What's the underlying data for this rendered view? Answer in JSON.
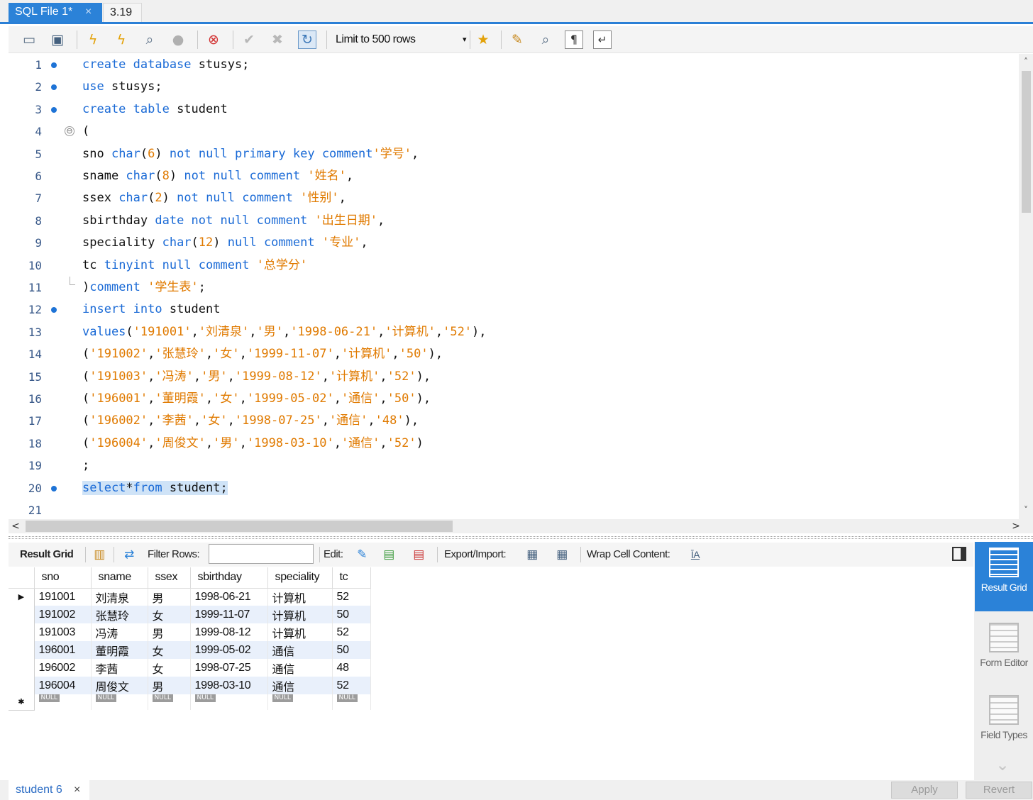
{
  "tabs": [
    {
      "label": "SQL File 1*",
      "close": "×"
    },
    {
      "label": "3.19"
    }
  ],
  "toolbar": {
    "limit_label": "Limit to 500 rows",
    "dropdown_arrow": "▾",
    "icons": [
      "open-folder-icon",
      "save-icon",
      "execute-icon",
      "execute-current-icon",
      "explain-icon",
      "stop-icon",
      "toggle-error-stop-icon",
      "commit-icon",
      "rollback-icon",
      "autocommit-icon",
      "add-snippet-icon",
      "beautify-icon",
      "find-icon",
      "invisible-chars-icon",
      "wrap-icon"
    ]
  },
  "editor": {
    "lines": [
      {
        "n": "1",
        "dot": true,
        "tokens": [
          [
            "k",
            "create database"
          ],
          [
            "t",
            " stusys;"
          ]
        ]
      },
      {
        "n": "2",
        "dot": true,
        "tokens": [
          [
            "k",
            "use"
          ],
          [
            "t",
            " stusys;"
          ]
        ]
      },
      {
        "n": "3",
        "dot": true,
        "tokens": [
          [
            "k",
            "create table"
          ],
          [
            "t",
            " student"
          ]
        ]
      },
      {
        "n": "4",
        "fold": "⊖",
        "tokens": [
          [
            "t",
            "("
          ]
        ]
      },
      {
        "n": "5",
        "tokens": [
          [
            "t",
            "sno "
          ],
          [
            "k",
            "char"
          ],
          [
            "t",
            "("
          ],
          [
            "s",
            "6"
          ],
          [
            "t",
            ") "
          ],
          [
            "k",
            "not null primary key comment"
          ],
          [
            "s",
            "'学号'"
          ],
          [
            "t",
            ","
          ]
        ]
      },
      {
        "n": "6",
        "tokens": [
          [
            "t",
            "sname "
          ],
          [
            "k",
            "char"
          ],
          [
            "t",
            "("
          ],
          [
            "s",
            "8"
          ],
          [
            "t",
            ") "
          ],
          [
            "k",
            "not null comment"
          ],
          [
            "t",
            " "
          ],
          [
            "s",
            "'姓名'"
          ],
          [
            "t",
            ","
          ]
        ]
      },
      {
        "n": "7",
        "tokens": [
          [
            "t",
            "ssex "
          ],
          [
            "k",
            "char"
          ],
          [
            "t",
            "("
          ],
          [
            "s",
            "2"
          ],
          [
            "t",
            ") "
          ],
          [
            "k",
            "not null comment"
          ],
          [
            "t",
            " "
          ],
          [
            "s",
            "'性别'"
          ],
          [
            "t",
            ","
          ]
        ]
      },
      {
        "n": "8",
        "tokens": [
          [
            "t",
            "sbirthday "
          ],
          [
            "k",
            "date not null comment"
          ],
          [
            "t",
            " "
          ],
          [
            "s",
            "'出生日期'"
          ],
          [
            "t",
            ","
          ]
        ]
      },
      {
        "n": "9",
        "tokens": [
          [
            "t",
            "speciality "
          ],
          [
            "k",
            "char"
          ],
          [
            "t",
            "("
          ],
          [
            "s",
            "12"
          ],
          [
            "t",
            ") "
          ],
          [
            "k",
            "null comment"
          ],
          [
            "t",
            " "
          ],
          [
            "s",
            "'专业'"
          ],
          [
            "t",
            ","
          ]
        ]
      },
      {
        "n": "10",
        "tokens": [
          [
            "t",
            "tc "
          ],
          [
            "k",
            "tinyint null comment"
          ],
          [
            "t",
            " "
          ],
          [
            "s",
            "'总学分'"
          ]
        ]
      },
      {
        "n": "11",
        "foldend": true,
        "tokens": [
          [
            "t",
            ")"
          ],
          [
            "k",
            "comment"
          ],
          [
            "t",
            " "
          ],
          [
            "s",
            "'学生表'"
          ],
          [
            "t",
            ";"
          ]
        ]
      },
      {
        "n": "12",
        "dot": true,
        "tokens": [
          [
            "k",
            "insert into"
          ],
          [
            "t",
            " student"
          ]
        ]
      },
      {
        "n": "13",
        "tokens": [
          [
            "k",
            "values"
          ],
          [
            "t",
            "("
          ],
          [
            "s",
            "'191001'"
          ],
          [
            "t",
            ","
          ],
          [
            "s",
            "'刘清泉'"
          ],
          [
            "t",
            ","
          ],
          [
            "s",
            "'男'"
          ],
          [
            "t",
            ","
          ],
          [
            "s",
            "'1998-06-21'"
          ],
          [
            "t",
            ","
          ],
          [
            "s",
            "'计算机'"
          ],
          [
            "t",
            ","
          ],
          [
            "s",
            "'52'"
          ],
          [
            "t",
            "),"
          ]
        ]
      },
      {
        "n": "14",
        "tokens": [
          [
            "t",
            "("
          ],
          [
            "s",
            "'191002'"
          ],
          [
            "t",
            ","
          ],
          [
            "s",
            "'张慧玲'"
          ],
          [
            "t",
            ","
          ],
          [
            "s",
            "'女'"
          ],
          [
            "t",
            ","
          ],
          [
            "s",
            "'1999-11-07'"
          ],
          [
            "t",
            ","
          ],
          [
            "s",
            "'计算机'"
          ],
          [
            "t",
            ","
          ],
          [
            "s",
            "'50'"
          ],
          [
            "t",
            "),"
          ]
        ]
      },
      {
        "n": "15",
        "tokens": [
          [
            "t",
            "("
          ],
          [
            "s",
            "'191003'"
          ],
          [
            "t",
            ","
          ],
          [
            "s",
            "'冯涛'"
          ],
          [
            "t",
            ","
          ],
          [
            "s",
            "'男'"
          ],
          [
            "t",
            ","
          ],
          [
            "s",
            "'1999-08-12'"
          ],
          [
            "t",
            ","
          ],
          [
            "s",
            "'计算机'"
          ],
          [
            "t",
            ","
          ],
          [
            "s",
            "'52'"
          ],
          [
            "t",
            "),"
          ]
        ]
      },
      {
        "n": "16",
        "tokens": [
          [
            "t",
            "("
          ],
          [
            "s",
            "'196001'"
          ],
          [
            "t",
            ","
          ],
          [
            "s",
            "'董明霞'"
          ],
          [
            "t",
            ","
          ],
          [
            "s",
            "'女'"
          ],
          [
            "t",
            ","
          ],
          [
            "s",
            "'1999-05-02'"
          ],
          [
            "t",
            ","
          ],
          [
            "s",
            "'通信'"
          ],
          [
            "t",
            ","
          ],
          [
            "s",
            "'50'"
          ],
          [
            "t",
            "),"
          ]
        ]
      },
      {
        "n": "17",
        "tokens": [
          [
            "t",
            "("
          ],
          [
            "s",
            "'196002'"
          ],
          [
            "t",
            ","
          ],
          [
            "s",
            "'李茜'"
          ],
          [
            "t",
            ","
          ],
          [
            "s",
            "'女'"
          ],
          [
            "t",
            ","
          ],
          [
            "s",
            "'1998-07-25'"
          ],
          [
            "t",
            ","
          ],
          [
            "s",
            "'通信'"
          ],
          [
            "t",
            ","
          ],
          [
            "s",
            "'48'"
          ],
          [
            "t",
            "),"
          ]
        ]
      },
      {
        "n": "18",
        "tokens": [
          [
            "t",
            "("
          ],
          [
            "s",
            "'196004'"
          ],
          [
            "t",
            ","
          ],
          [
            "s",
            "'周俊文'"
          ],
          [
            "t",
            ","
          ],
          [
            "s",
            "'男'"
          ],
          [
            "t",
            ","
          ],
          [
            "s",
            "'1998-03-10'"
          ],
          [
            "t",
            ","
          ],
          [
            "s",
            "'通信'"
          ],
          [
            "t",
            ","
          ],
          [
            "s",
            "'52'"
          ],
          [
            "t",
            ")"
          ]
        ]
      },
      {
        "n": "19",
        "tokens": [
          [
            "t",
            ";"
          ]
        ]
      },
      {
        "n": "20",
        "dot": true,
        "selected": true,
        "tokens": [
          [
            "k",
            "select"
          ],
          [
            "t",
            "*"
          ],
          [
            "k",
            "from"
          ],
          [
            "t",
            " student;"
          ]
        ]
      },
      {
        "n": "21",
        "tokens": []
      }
    ]
  },
  "scroll": {
    "up": "˄",
    "down": "˅",
    "left": "<",
    "right": ">"
  },
  "result_toolbar": {
    "result_grid_label": "Result Grid",
    "filter_label": "Filter Rows:",
    "filter_value": "",
    "edit_label": "Edit:",
    "export_label": "Export/Import:",
    "wrap_label": "Wrap Cell Content:",
    "wrap_icon_glyph": "ĪA"
  },
  "grid": {
    "columns": [
      "sno",
      "sname",
      "ssex",
      "sbirthday",
      "speciality",
      "tc"
    ],
    "rows": [
      [
        "191001",
        "刘清泉",
        "男",
        "1998-06-21",
        "计算机",
        "52"
      ],
      [
        "191002",
        "张慧玲",
        "女",
        "1999-11-07",
        "计算机",
        "50"
      ],
      [
        "191003",
        "冯涛",
        "男",
        "1999-08-12",
        "计算机",
        "52"
      ],
      [
        "196001",
        "董明霞",
        "女",
        "1999-05-02",
        "通信",
        "50"
      ],
      [
        "196002",
        "李茜",
        "女",
        "1998-07-25",
        "通信",
        "48"
      ],
      [
        "196004",
        "周俊文",
        "男",
        "1998-03-10",
        "通信",
        "52"
      ]
    ],
    "null_label": "NULL",
    "current_row_marker": "▶",
    "new_row_marker": "✱"
  },
  "side_panel": {
    "result_grid": "Result Grid",
    "form_editor": "Form Editor",
    "field_types": "Field Types"
  },
  "bottom": {
    "result_tab": "student 6",
    "close": "×",
    "apply": "Apply",
    "revert": "Revert"
  },
  "colors": {
    "accent": "#2b82d8",
    "keyword": "#1a6ad6",
    "string": "#e07a00",
    "selection": "#cfe3f7",
    "alt_row": "#e9f0fb"
  }
}
